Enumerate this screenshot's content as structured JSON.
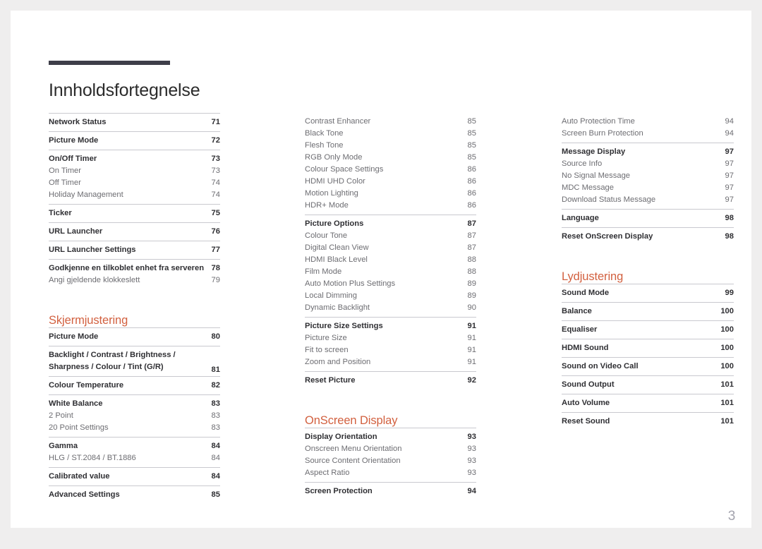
{
  "document": {
    "title": "Innholdsfortegnelse",
    "folio": "3",
    "accent_color": "#d2603f",
    "rule_color": "#3e3e49",
    "separator_color": "#c9c9cf"
  },
  "columns": [
    {
      "id": "column-1",
      "blocks": [
        {
          "type": "group",
          "rule": true,
          "rows": [
            {
              "label": "Network Status",
              "page": "71",
              "level": "primary"
            }
          ]
        },
        {
          "type": "group",
          "rule": true,
          "rows": [
            {
              "label": "Picture Mode",
              "page": "72",
              "level": "primary"
            }
          ]
        },
        {
          "type": "group",
          "rule": true,
          "rows": [
            {
              "label": "On/Off Timer",
              "page": "73",
              "level": "primary"
            },
            {
              "label": "On Timer",
              "page": "73",
              "level": "sub"
            },
            {
              "label": "Off Timer",
              "page": "74",
              "level": "sub"
            },
            {
              "label": "Holiday Management",
              "page": "74",
              "level": "sub"
            }
          ]
        },
        {
          "type": "group",
          "rule": true,
          "rows": [
            {
              "label": "Ticker",
              "page": "75",
              "level": "primary"
            }
          ]
        },
        {
          "type": "group",
          "rule": true,
          "rows": [
            {
              "label": "URL Launcher",
              "page": "76",
              "level": "primary"
            }
          ]
        },
        {
          "type": "group",
          "rule": true,
          "rows": [
            {
              "label": "URL Launcher Settings",
              "page": "77",
              "level": "primary"
            }
          ]
        },
        {
          "type": "group",
          "rule": true,
          "rows": [
            {
              "label": "Godkjenne en tilkoblet enhet fra serveren",
              "page": "78",
              "level": "primary"
            },
            {
              "label": "Angi gjeldende klokkeslett",
              "page": "79",
              "level": "sub"
            }
          ]
        },
        {
          "type": "spacer",
          "size": "lg"
        },
        {
          "type": "heading",
          "label": "Skjermjustering"
        },
        {
          "type": "group",
          "rule": true,
          "rows": [
            {
              "label": "Picture Mode",
              "page": "80",
              "level": "primary"
            }
          ]
        },
        {
          "type": "group",
          "rule": true,
          "rows": [
            {
              "label": "Backlight / Contrast / Brightness / Sharpness / Colour / Tint (G/R)",
              "page": "81",
              "level": "primary",
              "wrap": true
            }
          ]
        },
        {
          "type": "group",
          "rule": true,
          "rows": [
            {
              "label": "Colour Temperature",
              "page": "82",
              "level": "primary"
            }
          ]
        },
        {
          "type": "group",
          "rule": true,
          "rows": [
            {
              "label": "White Balance",
              "page": "83",
              "level": "primary"
            },
            {
              "label": "2 Point",
              "page": "83",
              "level": "sub"
            },
            {
              "label": "20 Point Settings",
              "page": "83",
              "level": "sub"
            }
          ]
        },
        {
          "type": "group",
          "rule": true,
          "rows": [
            {
              "label": "Gamma",
              "page": "84",
              "level": "primary"
            },
            {
              "label": "HLG / ST.2084 / BT.1886",
              "page": "84",
              "level": "sub"
            }
          ]
        },
        {
          "type": "group",
          "rule": true,
          "rows": [
            {
              "label": "Calibrated value",
              "page": "84",
              "level": "primary"
            }
          ]
        },
        {
          "type": "group",
          "rule": true,
          "rows": [
            {
              "label": "Advanced Settings",
              "page": "85",
              "level": "primary"
            }
          ]
        }
      ]
    },
    {
      "id": "column-2",
      "blocks": [
        {
          "type": "group",
          "rule": false,
          "rows": [
            {
              "label": "Contrast Enhancer",
              "page": "85",
              "level": "sub"
            },
            {
              "label": "Black Tone",
              "page": "85",
              "level": "sub"
            },
            {
              "label": "Flesh Tone",
              "page": "85",
              "level": "sub"
            },
            {
              "label": "RGB Only Mode",
              "page": "85",
              "level": "sub"
            },
            {
              "label": "Colour Space Settings",
              "page": "86",
              "level": "sub"
            },
            {
              "label": "HDMI UHD Color",
              "page": "86",
              "level": "sub"
            },
            {
              "label": "Motion Lighting",
              "page": "86",
              "level": "sub"
            },
            {
              "label": "HDR+ Mode",
              "page": "86",
              "level": "sub"
            }
          ]
        },
        {
          "type": "group",
          "rule": true,
          "rows": [
            {
              "label": "Picture Options",
              "page": "87",
              "level": "primary"
            },
            {
              "label": "Colour Tone",
              "page": "87",
              "level": "sub"
            },
            {
              "label": "Digital Clean View",
              "page": "87",
              "level": "sub"
            },
            {
              "label": "HDMI Black Level",
              "page": "88",
              "level": "sub"
            },
            {
              "label": "Film Mode",
              "page": "88",
              "level": "sub"
            },
            {
              "label": "Auto Motion Plus Settings",
              "page": "89",
              "level": "sub"
            },
            {
              "label": "Local Dimming",
              "page": "89",
              "level": "sub"
            },
            {
              "label": "Dynamic Backlight",
              "page": "90",
              "level": "sub"
            }
          ]
        },
        {
          "type": "group",
          "rule": true,
          "rows": [
            {
              "label": "Picture Size Settings",
              "page": "91",
              "level": "primary"
            },
            {
              "label": "Picture Size",
              "page": "91",
              "level": "sub"
            },
            {
              "label": "Fit to screen",
              "page": "91",
              "level": "sub"
            },
            {
              "label": "Zoom and Position",
              "page": "91",
              "level": "sub"
            }
          ]
        },
        {
          "type": "group",
          "rule": true,
          "rows": [
            {
              "label": "Reset Picture",
              "page": "92",
              "level": "primary"
            }
          ]
        },
        {
          "type": "spacer",
          "size": "lg"
        },
        {
          "type": "heading",
          "label": "OnScreen Display"
        },
        {
          "type": "group",
          "rule": true,
          "rows": [
            {
              "label": "Display Orientation",
              "page": "93",
              "level": "primary"
            },
            {
              "label": "Onscreen Menu Orientation",
              "page": "93",
              "level": "sub"
            },
            {
              "label": "Source Content Orientation",
              "page": "93",
              "level": "sub"
            },
            {
              "label": "Aspect Ratio",
              "page": "93",
              "level": "sub"
            }
          ]
        },
        {
          "type": "group",
          "rule": true,
          "rows": [
            {
              "label": "Screen Protection",
              "page": "94",
              "level": "primary"
            }
          ]
        }
      ]
    },
    {
      "id": "column-3",
      "blocks": [
        {
          "type": "group",
          "rule": false,
          "rows": [
            {
              "label": "Auto Protection Time",
              "page": "94",
              "level": "sub"
            },
            {
              "label": "Screen Burn Protection",
              "page": "94",
              "level": "sub"
            }
          ]
        },
        {
          "type": "group",
          "rule": true,
          "rows": [
            {
              "label": "Message Display",
              "page": "97",
              "level": "primary"
            },
            {
              "label": "Source Info",
              "page": "97",
              "level": "sub"
            },
            {
              "label": "No Signal Message",
              "page": "97",
              "level": "sub"
            },
            {
              "label": "MDC Message",
              "page": "97",
              "level": "sub"
            },
            {
              "label": "Download Status Message",
              "page": "97",
              "level": "sub"
            }
          ]
        },
        {
          "type": "group",
          "rule": true,
          "rows": [
            {
              "label": "Language",
              "page": "98",
              "level": "primary"
            }
          ]
        },
        {
          "type": "group",
          "rule": true,
          "rows": [
            {
              "label": "Reset OnScreen Display",
              "page": "98",
              "level": "primary"
            }
          ]
        },
        {
          "type": "spacer",
          "size": "lg"
        },
        {
          "type": "heading",
          "label": "Lydjustering"
        },
        {
          "type": "group",
          "rule": true,
          "rows": [
            {
              "label": "Sound Mode",
              "page": "99",
              "level": "primary"
            }
          ]
        },
        {
          "type": "group",
          "rule": true,
          "rows": [
            {
              "label": "Balance",
              "page": "100",
              "level": "primary"
            }
          ]
        },
        {
          "type": "group",
          "rule": true,
          "rows": [
            {
              "label": "Equaliser",
              "page": "100",
              "level": "primary"
            }
          ]
        },
        {
          "type": "group",
          "rule": true,
          "rows": [
            {
              "label": "HDMI Sound",
              "page": "100",
              "level": "primary"
            }
          ]
        },
        {
          "type": "group",
          "rule": true,
          "rows": [
            {
              "label": "Sound on Video Call",
              "page": "100",
              "level": "primary"
            }
          ]
        },
        {
          "type": "group",
          "rule": true,
          "rows": [
            {
              "label": "Sound Output",
              "page": "101",
              "level": "primary"
            }
          ]
        },
        {
          "type": "group",
          "rule": true,
          "rows": [
            {
              "label": "Auto Volume",
              "page": "101",
              "level": "primary"
            }
          ]
        },
        {
          "type": "group",
          "rule": true,
          "rows": [
            {
              "label": "Reset Sound",
              "page": "101",
              "level": "primary"
            }
          ]
        }
      ]
    }
  ]
}
